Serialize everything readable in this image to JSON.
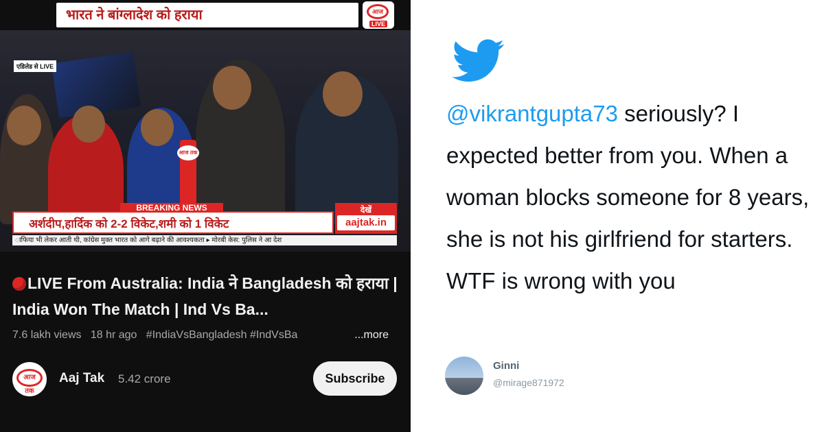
{
  "video": {
    "headline": "भारत ने बांग्लादेश को हराया",
    "logo_text": "आज तक",
    "live_label": "LIVE",
    "location": "एडिलेड से LIVE",
    "mic_text": "आज तक",
    "breaking_label": "BREAKING NEWS",
    "breaking_text": "अर्शदीप,हार्दिक को 2-2 विकेट,शमी को 1 विकेट",
    "dekhen_label": "देखें",
    "dekhen_site": "aajtak.in",
    "ticker_text": "ाफिया भी लेकर आती थी, कांग्रेस मुक्त भारत को आगे बढ़ाने की आवश्यकता  ▸ मोरबी केस: पुलिस ने आ    देश"
  },
  "youtube": {
    "title": "LIVE From Australia: India ने Bangladesh को हराया | India Won The Match | Ind Vs Ba...",
    "views": "7.6 lakh views",
    "age": "18 hr ago",
    "hashtags": "#IndiaVsBangladesh #IndVsBa",
    "more_label": "...more",
    "channel_logo_text": "आज तक",
    "channel_name": "Aaj Tak",
    "subscribers": "5.42 crore",
    "subscribe_label": "Subscribe"
  },
  "tweet": {
    "icon": "twitter-bird-icon",
    "brand_color": "#1d9bf0",
    "mention": "@vikrantgupta73",
    "text": " seriously? I expected better from you. When a woman blocks someone for 8 years, she is not his girlfriend for starters. WTF is wrong with you",
    "author_name": "Ginni",
    "author_handle": "@mirage871972"
  }
}
